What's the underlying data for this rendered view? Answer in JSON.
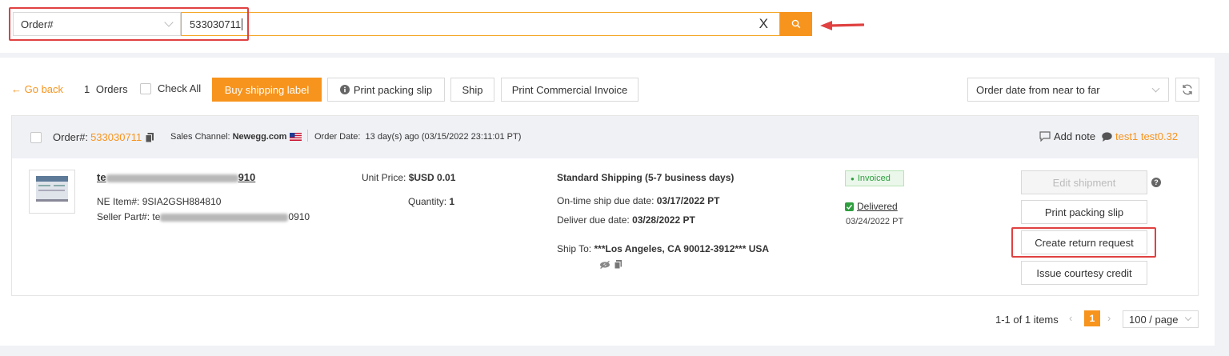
{
  "search": {
    "field_label": "Order#",
    "value": "533030711",
    "clear_label": "X"
  },
  "toolbar": {
    "go_back": "← Go back",
    "orders_count": "1",
    "orders_label": "Orders",
    "check_all": "Check All",
    "buy_shipping_label": "Buy shipping label",
    "print_packing_slip": "Print packing slip",
    "ship": "Ship",
    "print_commercial_invoice": "Print Commercial Invoice",
    "sort_value": "Order date from near to far"
  },
  "order": {
    "order_label": "Order#:",
    "order_number": "533030711",
    "sales_channel_label": "Sales Channel:",
    "sales_channel": "Newegg.com",
    "order_date_label": "Order Date:",
    "order_date": "13 day(s) ago (03/15/2022 23:11:01 PT)",
    "add_note": "Add note",
    "note_text": "test1 test0.32",
    "item_name_start": "te",
    "item_name_end": "910",
    "ne_item_label": "NE Item#:",
    "ne_item": "9SIA2GSH884810",
    "seller_part_label": "Seller Part#:",
    "seller_part_start": "te",
    "seller_part_end": "0910",
    "unit_price_label": "Unit Price:",
    "unit_price": "$USD 0.01",
    "quantity_label": "Quantity:",
    "quantity": "1",
    "shipping_method": "Standard Shipping (5-7 business days)",
    "ship_due_label": "On-time ship due date:",
    "ship_due": "03/17/2022 PT",
    "deliver_due_label": "Deliver due date:",
    "deliver_due": "03/28/2022 PT",
    "ship_to_label": "Ship To:",
    "ship_to": "***Los Angeles, CA 90012-3912*** USA",
    "status_invoiced": "Invoiced",
    "status_delivered": "Delivered",
    "delivered_date": "03/24/2022 PT",
    "actions": {
      "edit_shipment": "Edit shipment",
      "print_packing_slip": "Print packing slip",
      "create_return_request": "Create return request",
      "issue_courtesy_credit": "Issue courtesy credit"
    }
  },
  "pagination": {
    "summary": "1-1 of 1 items",
    "current_page": "1",
    "per_page": "100 / page"
  },
  "colors": {
    "accent": "#f7941d",
    "highlight": "#e04141",
    "success": "#2e9e3e"
  }
}
